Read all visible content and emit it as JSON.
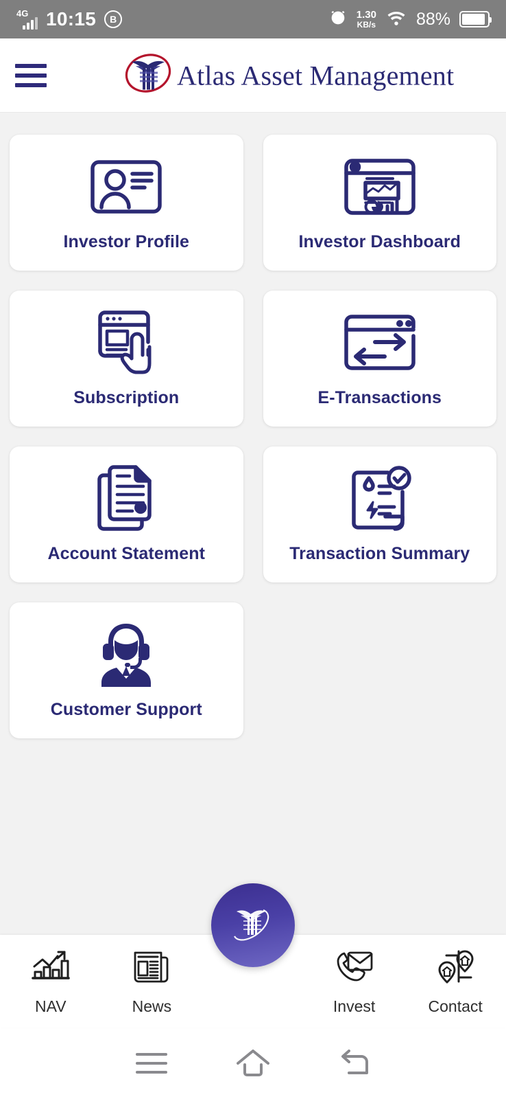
{
  "status_bar": {
    "network_type": "4G",
    "time": "10:15",
    "bluetooth_icon": "bluetooth-icon",
    "bt_glyph": "B",
    "alarm_icon": "alarm-icon",
    "data_speed_value": "1.30",
    "data_speed_unit": "KB/s",
    "wifi_icon": "wifi-icon",
    "battery_percent": "88%",
    "battery_icon": "battery-icon"
  },
  "header": {
    "menu_icon": "hamburger-menu-icon",
    "logo_icon": "atlas-logo-mark",
    "brand_name": "Atlas Asset Management"
  },
  "colors": {
    "brand_navy": "#2b2a74",
    "page_background": "#f2f2f2",
    "card_background": "#ffffff",
    "status_bar": "#7f7f7f",
    "fab_gradient_start": "#3c2f90",
    "fab_gradient_end": "#6f68c4"
  },
  "menu": {
    "tiles": [
      {
        "label": "Investor Profile",
        "icon": "id-card-icon"
      },
      {
        "label": "Investor Dashboard",
        "icon": "dashboard-charts-icon"
      },
      {
        "label": "Subscription",
        "icon": "browser-hand-click-icon"
      },
      {
        "label": "E-Transactions",
        "icon": "browser-exchange-arrows-icon"
      },
      {
        "label": "Account Statement",
        "icon": "documents-stack-icon"
      },
      {
        "label": "Transaction Summary",
        "icon": "receipt-check-icon"
      },
      {
        "label": "Customer Support",
        "icon": "headset-agent-icon"
      }
    ]
  },
  "bottom_nav": {
    "items": [
      {
        "label": "NAV",
        "icon": "growth-bar-chart-icon"
      },
      {
        "label": "News",
        "icon": "newspaper-icon"
      },
      {
        "label": "Invest",
        "icon": "phone-envelope-icon"
      },
      {
        "label": "Contact",
        "icon": "map-pins-icon"
      }
    ],
    "fab_icon": "atlas-logo-mark-white"
  },
  "system_nav": {
    "recents_icon": "recent-apps-icon",
    "home_icon": "home-icon",
    "back_icon": "back-icon"
  }
}
